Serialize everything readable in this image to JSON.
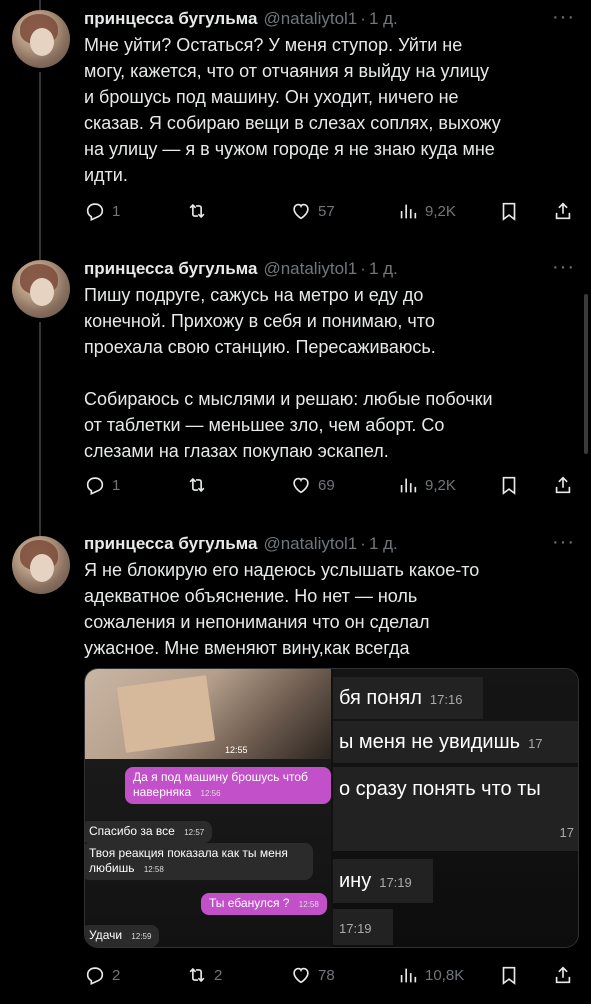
{
  "tweets": [
    {
      "name": "принцесса бугульма",
      "handle": "@nataliytol1",
      "time": "1 д.",
      "text": "Мне уйти? Остаться? У меня ступор. Уйти не\nмогу, кажется, что от отчаяния я выйду на улицу\nи брошусь под машину. Он уходит, ничего не\nсказав. Я собираю вещи в слезах соплях, выхожу\nна улицу — я в чужом городе я не знаю куда мне\nидти.",
      "replies": "1",
      "retweets": "",
      "likes": "57",
      "views": "9,2K"
    },
    {
      "name": "принцесса бугульма",
      "handle": "@nataliytol1",
      "time": "1 д.",
      "text": "Пишу подруге, сажусь на метро и еду до\nконечной. Прихожу в себя и понимаю, что\nпроехала свою станцию. Пересаживаюсь.\n\nСобираюсь с мыслями и решаю: любые побочки\nот таблетки — меньшее зло, чем аборт. Со\nслезами на глазах покупаю эскапел.",
      "replies": "1",
      "retweets": "",
      "likes": "69",
      "views": "9,2K"
    },
    {
      "name": "принцесса бугульма",
      "handle": "@nataliytol1",
      "time": "1 д.",
      "text": "Я не блокирую его надеюсь услышать какое-то\nадекватное объяснение. Но нет — ноль\nсожаления и непонимания что он сделал\nужасное. Мне вменяют вину,как  всегда",
      "replies": "2",
      "retweets": "2",
      "likes": "78",
      "views": "10,8K"
    }
  ],
  "media": {
    "left": {
      "photo_time": "12:55",
      "messages": [
        {
          "text": "Да я под машину брошусь чтоб наверняка",
          "time": "12:56",
          "side": "out"
        },
        {
          "text": "Спасибо за все",
          "time": "12:57",
          "side": "in"
        },
        {
          "text": "Твоя реакция показала как ты меня любишь",
          "time": "12:58",
          "side": "in"
        },
        {
          "text": "Ты ебанулся ?",
          "time": "12:58",
          "side": "out"
        },
        {
          "text": "Удачи",
          "time": "12:59",
          "side": "in"
        }
      ]
    },
    "right": {
      "messages": [
        {
          "text": "бя понял",
          "time": "17:16"
        },
        {
          "text": "ы меня не увидишь",
          "time": "17"
        },
        {
          "text": "о сразу понять что ты",
          "time": ""
        },
        {
          "text": "",
          "time": "17"
        },
        {
          "text": "ину",
          "time": "17:19"
        },
        {
          "text": "",
          "time": "17:19"
        }
      ]
    }
  },
  "colors": {
    "background": "#000000",
    "text": "#e7e9ea",
    "secondary": "#71767b",
    "thread_line": "#333639",
    "chat_pink": "#c250c9"
  },
  "icons": [
    "reply-icon",
    "retweet-icon",
    "like-icon",
    "views-icon",
    "bookmark-icon",
    "share-icon",
    "more-icon"
  ]
}
